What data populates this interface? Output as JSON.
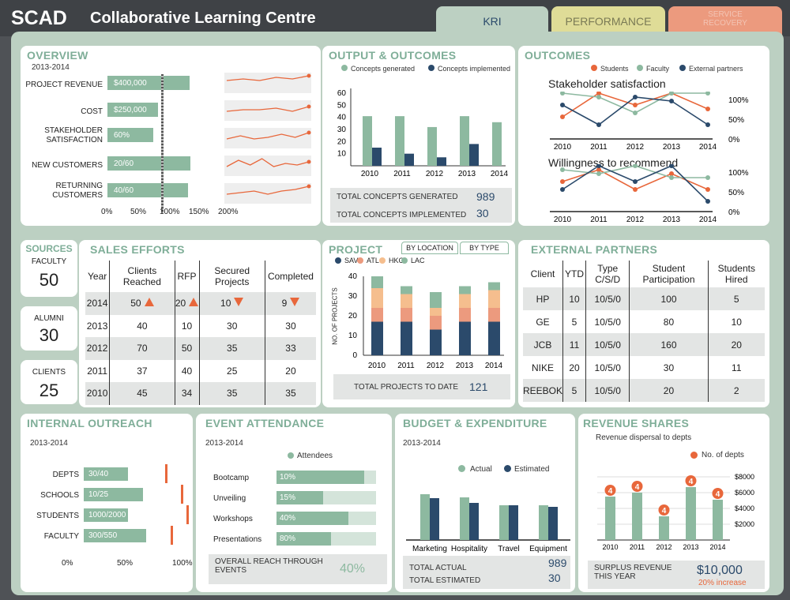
{
  "header": {
    "brand": "SCAD",
    "title": "Collaborative Learning Centre",
    "tabs": [
      {
        "label": "KRI"
      },
      {
        "label": "PERFORMANCE"
      },
      {
        "label": "SERVICE RECOVERY"
      }
    ]
  },
  "colors": {
    "green": "#8db9a0",
    "navy": "#2b4a6b",
    "orange": "#e8673b",
    "peach": "#f5be8e",
    "salmon": "#ec9a7e",
    "frame": "#bcd0c2"
  },
  "overview": {
    "title": "OVERVIEW",
    "period": "2013-2014",
    "items": [
      {
        "label": "PROJECT REVENUE",
        "value": "$400,000",
        "pct": 140
      },
      {
        "label": "COST",
        "value": "$250,000",
        "pct": 87
      },
      {
        "label": "STAKEHOLDER SATISFACTION",
        "value": "60%",
        "pct": 79
      },
      {
        "label": "NEW CUSTOMERS",
        "value": "20/60",
        "pct": 142
      },
      {
        "label": "RETURNING CUSTOMERS",
        "value": "40/60",
        "pct": 138
      }
    ],
    "axis": [
      "0%",
      "50%",
      "100%",
      "150%",
      "200%"
    ]
  },
  "output": {
    "title": "OUTPUT & OUTCOMES",
    "legend": [
      "Concepts generated",
      "Concepts implemented"
    ],
    "yticks": [
      "60",
      "50",
      "40",
      "30",
      "20",
      "10"
    ],
    "chart_data": {
      "type": "bar",
      "categories": [
        "2010",
        "2011",
        "2012",
        "2013",
        "2014"
      ],
      "series": [
        {
          "name": "Concepts generated",
          "values": [
            41,
            41,
            32,
            41,
            36
          ]
        },
        {
          "name": "Concepts implemented",
          "values": [
            15,
            10,
            7,
            18,
            0
          ]
        }
      ],
      "ylim": [
        0,
        60
      ]
    },
    "totals": [
      {
        "label": "TOTAL CONCEPTS GENERATED",
        "value": "989"
      },
      {
        "label": "TOTAL CONCEPTS IMPLEMENTED",
        "value": "30"
      }
    ]
  },
  "outcomes": {
    "title": "OUTCOMES",
    "legend": [
      "Students",
      "Faculty",
      "External partners"
    ],
    "chart1": {
      "title": "Stakeholder satisfaction"
    },
    "chart2": {
      "title": "Willingness to recommend"
    },
    "yticks": [
      "100%",
      "50%",
      "0%"
    ],
    "years": [
      "2010",
      "2011",
      "2012",
      "2013",
      "2014"
    ],
    "chart_data": [
      {
        "type": "line",
        "title": "Stakeholder satisfaction",
        "x": [
          "2010",
          "2011",
          "2012",
          "2013",
          "2014"
        ],
        "series": [
          {
            "name": "Students",
            "values": [
              40,
              100,
              70,
              100,
              60
            ]
          },
          {
            "name": "Faculty",
            "values": [
              100,
              90,
              50,
              100,
              100
            ]
          },
          {
            "name": "External partners",
            "values": [
              70,
              20,
              90,
              80,
              20
            ]
          }
        ],
        "ylim": [
          0,
          100
        ]
      },
      {
        "type": "line",
        "title": "Willingness to recommend",
        "x": [
          "2010",
          "2011",
          "2012",
          "2013",
          "2014"
        ],
        "series": [
          {
            "name": "Students",
            "values": [
              60,
              90,
              40,
              80,
              40
            ]
          },
          {
            "name": "Faculty",
            "values": [
              90,
              80,
              100,
              70,
              70
            ]
          },
          {
            "name": "External partners",
            "values": [
              40,
              100,
              60,
              100,
              10
            ]
          }
        ],
        "ylim": [
          0,
          100
        ]
      }
    ]
  },
  "sources": {
    "title": "SOURCES",
    "items": [
      {
        "label": "FACULTY",
        "value": "50"
      },
      {
        "label": "ALUMNI",
        "value": "30"
      },
      {
        "label": "CLIENTS",
        "value": "25"
      }
    ]
  },
  "sales": {
    "title": "SALES EFFORTS",
    "headers": [
      "Year",
      "Clients Reached",
      "RFP",
      "Secured Projects",
      "Completed"
    ],
    "rows": [
      [
        "2014",
        "50",
        "20",
        "10",
        "9"
      ],
      [
        "2013",
        "40",
        "10",
        "30",
        "30"
      ],
      [
        "2012",
        "70",
        "50",
        "35",
        "33"
      ],
      [
        "2011",
        "37",
        "40",
        "25",
        "20"
      ],
      [
        "2010",
        "45",
        "34",
        "35",
        "35"
      ]
    ],
    "trend": [
      "up",
      "up",
      "down",
      "down"
    ]
  },
  "project": {
    "title": "PROJECT",
    "tabs": [
      "BY LOCATION",
      "BY TYPE"
    ],
    "legend": [
      "SAV",
      "ATL",
      "HKG",
      "LAC"
    ],
    "ylabel": "NO. OF PROJECTS",
    "yticks": [
      "40",
      "30",
      "20",
      "10",
      "0"
    ],
    "chart_data": {
      "type": "bar",
      "categories": [
        "2010",
        "2011",
        "2012",
        "2013",
        "2014"
      ],
      "series": [
        {
          "name": "SAV",
          "values": [
            17,
            17,
            13,
            17,
            17
          ]
        },
        {
          "name": "ATL",
          "values": [
            7,
            7,
            7,
            7,
            7
          ]
        },
        {
          "name": "HKG",
          "values": [
            10,
            7,
            4,
            7,
            9
          ]
        },
        {
          "name": "LAC",
          "values": [
            6,
            4,
            8,
            4,
            4
          ]
        }
      ],
      "ylim": [
        0,
        40
      ]
    },
    "total": {
      "label": "TOTAL PROJECTS TO DATE",
      "value": "121"
    }
  },
  "partners": {
    "title": "EXTERNAL PARTNERS",
    "headers": [
      "Client",
      "YTD",
      "Type C/S/D",
      "Student Participation",
      "Students Hired"
    ],
    "rows": [
      [
        "HP",
        "10",
        "10/5/0",
        "100",
        "5"
      ],
      [
        "GE",
        "5",
        "10/5/0",
        "80",
        "10"
      ],
      [
        "JCB",
        "11",
        "10/5/0",
        "160",
        "20"
      ],
      [
        "NIKE",
        "20",
        "10/5/0",
        "30",
        "11"
      ],
      [
        "REEBOK",
        "5",
        "10/5/0",
        "20",
        "2"
      ]
    ]
  },
  "outreach": {
    "title": "INTERNAL OUTREACH",
    "period": "2013-2014",
    "items": [
      {
        "label": "DEPTS",
        "value": "30/40",
        "fill": 0.75,
        "target": 0.75
      },
      {
        "label": "SCHOOLS",
        "value": "10/25",
        "fill": 1.0,
        "target": 0.9
      },
      {
        "label": "STUDENTS",
        "value": "1000/2000",
        "fill": 0.75,
        "target": 0.95
      },
      {
        "label": "FACULTY",
        "value": "300/550",
        "fill": 1.05,
        "target": 0.8
      }
    ],
    "axis": [
      "0%",
      "50%",
      "100%"
    ]
  },
  "events": {
    "title": "EVENT ATTENDANCE",
    "period": "2013-2014",
    "legend": "Attendees",
    "items": [
      {
        "label": "Bootcamp",
        "value": "10%",
        "fill": 0.88
      },
      {
        "label": "Unveiling",
        "value": "15%",
        "fill": 0.47
      },
      {
        "label": "Workshops",
        "value": "40%",
        "fill": 0.72
      },
      {
        "label": "Presentations",
        "value": "80%",
        "fill": 0.55
      }
    ],
    "reach": {
      "label": "OVERALL REACH THROUGH EVENTS",
      "value": "40%"
    }
  },
  "budget": {
    "title": "BUDGET &  EXPENDITURE",
    "period": "2013-2014",
    "legend": [
      "Actual",
      "Estimated"
    ],
    "chart_data": {
      "type": "bar",
      "categories": [
        "Marketing",
        "Hospitality",
        "Travel",
        "Equipment"
      ],
      "series": [
        {
          "name": "Actual",
          "values": [
            58,
            54,
            44,
            44
          ]
        },
        {
          "name": "Estimated",
          "values": [
            53,
            47,
            44,
            42
          ]
        }
      ]
    },
    "totals": [
      {
        "label": "TOTAL ACTUAL",
        "value": "989"
      },
      {
        "label": "TOTAL ESTIMATED",
        "value": "30"
      }
    ]
  },
  "revenue": {
    "title": "REVENUE SHARES",
    "subtitle": "Revenue dispersal to depts",
    "legend": "No. of depts",
    "yticks": [
      "$8000",
      "$6000",
      "$4000",
      "$2000"
    ],
    "chart_data": {
      "type": "bar",
      "categories": [
        "2010",
        "2011",
        "2012",
        "2013",
        "2014"
      ],
      "series": [
        {
          "name": "Revenue",
          "values": [
            5500,
            6000,
            3000,
            6700,
            5100
          ]
        }
      ],
      "labels": [
        "4",
        "4",
        "4",
        "4",
        "4"
      ],
      "ylim": [
        0,
        9000
      ]
    },
    "surplus": {
      "label": "SURPLUS REVENUE THIS YEAR",
      "value": "$10,000",
      "change": "20% increase"
    }
  }
}
